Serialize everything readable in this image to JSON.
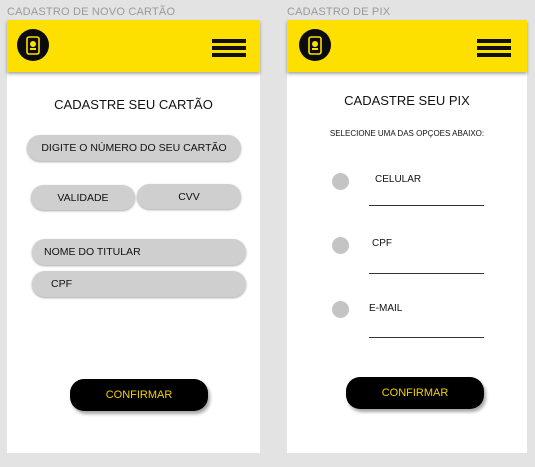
{
  "frames": {
    "card": {
      "label": "CADASTRO DE NOVO CARTÃO",
      "title": "CADASTRE SEU CARTÃO",
      "fields": {
        "card_number": "DIGITE O NÚMERO DO SEU CARTÃO",
        "validity": "VALIDADE",
        "cvv": "CVV",
        "holder_name": "NOME DO TITULAR",
        "cpf": "CPF"
      },
      "confirm_label": "CONFIRMAR"
    },
    "pix": {
      "label": "CADASTRO DE PIX",
      "title": "CADASTRE SEU PIX",
      "subtitle": "SELECIONE UMA DAS OPÇOES ABAIXO:",
      "options": [
        {
          "label": "CELULAR"
        },
        {
          "label": "CPF"
        },
        {
          "label": "E-MAIL"
        }
      ],
      "confirm_label": "CONFIRMAR"
    }
  },
  "colors": {
    "header": "#fde000",
    "button": "#000000",
    "button_text": "#f2d200",
    "field": "#cfcfcf"
  },
  "icons": {
    "logo": "card-robot-icon",
    "menu": "hamburger-menu-icon"
  }
}
